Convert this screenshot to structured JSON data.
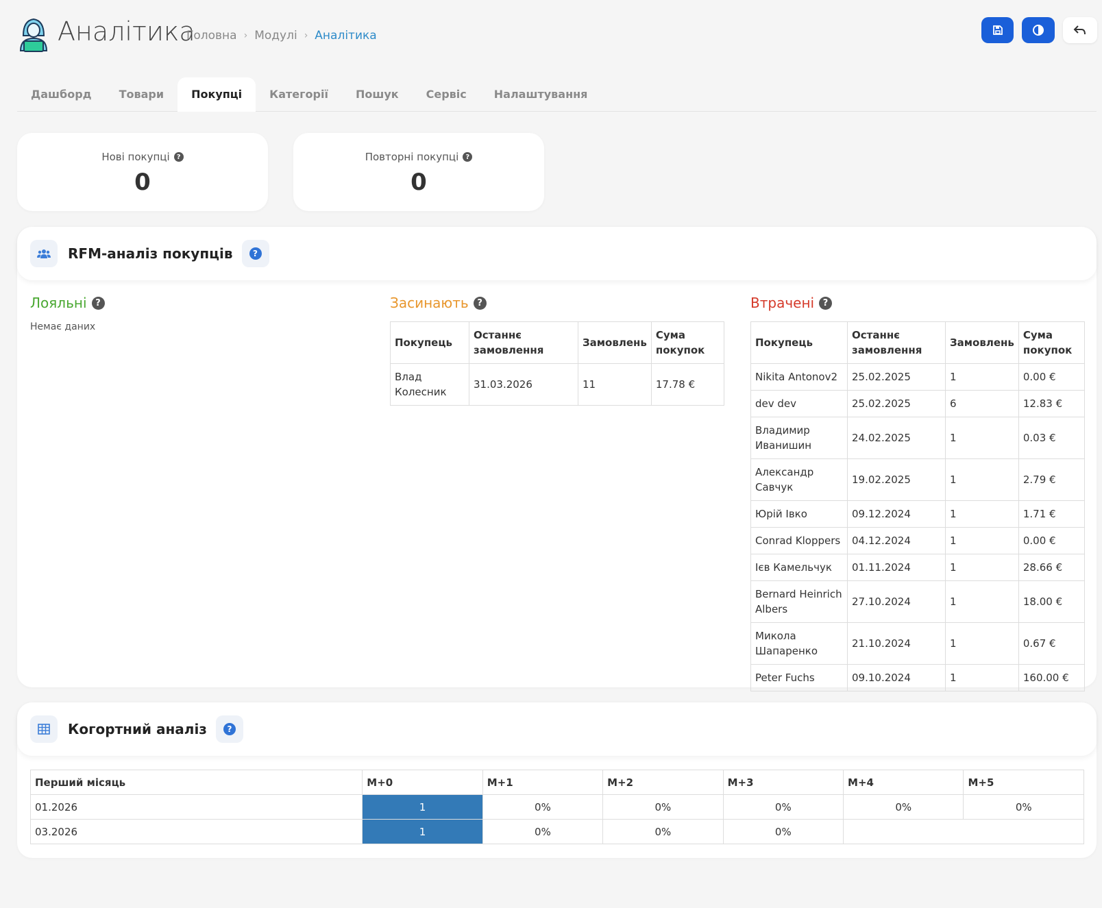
{
  "header": {
    "title": "Аналітика",
    "breadcrumb": [
      "Головна",
      "Модулі",
      "Аналітика"
    ],
    "buttons": {
      "save_icon": "save-icon",
      "theme_icon": "contrast-icon",
      "back_icon": "undo-icon"
    }
  },
  "tabs": [
    "Дашборд",
    "Товари",
    "Покупці",
    "Категорії",
    "Пошук",
    "Сервіс",
    "Налаштування"
  ],
  "active_tab": "Покупці",
  "stats": [
    {
      "label": "Нові покупці",
      "value": "0"
    },
    {
      "label": "Повторні покупці",
      "value": "0"
    }
  ],
  "rfm": {
    "title": "RFM-аналіз покупців",
    "headers": [
      "Покупець",
      "Останнє замовлення",
      "Замовлень",
      "Сума покупок"
    ],
    "loyal": {
      "title": "Лояльні",
      "empty": "Немає даних"
    },
    "sleeping": {
      "title": "Засинають",
      "rows": [
        [
          "Влад Колесник",
          "31.03.2026",
          "11",
          "17.78 €"
        ]
      ]
    },
    "lost": {
      "title": "Втрачені",
      "rows": [
        [
          "Nikita Antonov2",
          "25.02.2025",
          "1",
          "0.00 €"
        ],
        [
          "dev dev",
          "25.02.2025",
          "6",
          "12.83 €"
        ],
        [
          "Владимир Иванишин",
          "24.02.2025",
          "1",
          "0.03 €"
        ],
        [
          "Александр Савчук",
          "19.02.2025",
          "1",
          "2.79 €"
        ],
        [
          "Юрій Івко",
          "09.12.2024",
          "1",
          "1.71 €"
        ],
        [
          "Conrad Kloppers",
          "04.12.2024",
          "1",
          "0.00 €"
        ],
        [
          "Ієв Камельчук",
          "01.11.2024",
          "1",
          "28.66 €"
        ],
        [
          "Bernard Heinrich Albers",
          "27.10.2024",
          "1",
          "18.00 €"
        ],
        [
          "Микола Шапаренко",
          "21.10.2024",
          "1",
          "0.67 €"
        ],
        [
          "Peter Fuchs",
          "09.10.2024",
          "1",
          "160.00 €"
        ]
      ]
    }
  },
  "cohort": {
    "title": "Когортний аналіз",
    "headers": [
      "Перший місяць",
      "M+0",
      "M+1",
      "M+2",
      "M+3",
      "M+4",
      "M+5"
    ],
    "rows": [
      {
        "month": "01.2026",
        "cells": [
          "1",
          "0%",
          "0%",
          "0%",
          "0%",
          "0%"
        ]
      },
      {
        "month": "03.2026",
        "cells": [
          "1",
          "0%",
          "0%",
          "0%"
        ]
      }
    ],
    "highlight_color": "#337ab7"
  },
  "colors": {
    "accent": "#1a5fd9",
    "loyal": "#4aa832",
    "sleeping": "#e8962c",
    "lost": "#d53a2a",
    "breadcrumb_active": "#2e8bc9"
  }
}
